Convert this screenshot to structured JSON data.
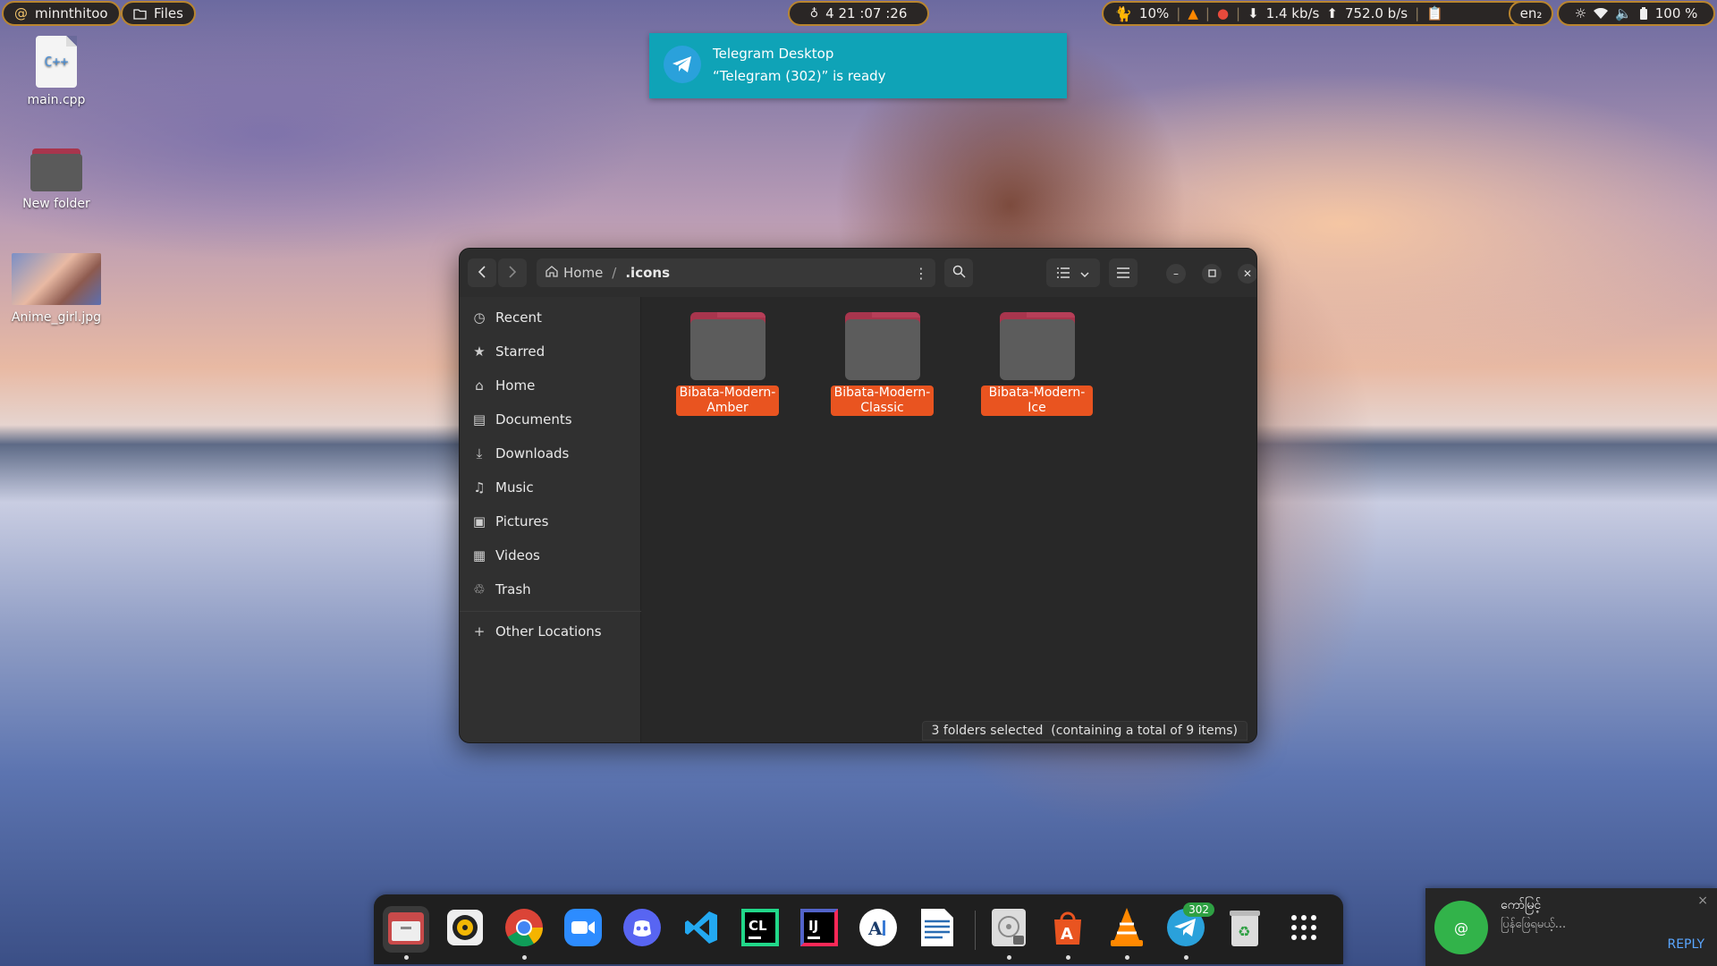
{
  "topbar": {
    "user": "minnthitoo",
    "user_icon": "at-sign-icon",
    "app": "Files",
    "clock": "4 21 :07 :26",
    "cpu": "10%",
    "net_down": "1.4 kb/s",
    "net_up": "752.0  b/s",
    "lang": "en₂",
    "battery": "100 %"
  },
  "desktop": {
    "items": [
      {
        "label": "main.cpp",
        "glyph": "C++"
      },
      {
        "label": "New folder"
      },
      {
        "label": "Anime_girl.jpg"
      }
    ]
  },
  "notification": {
    "app": "Telegram Desktop",
    "message": "“Telegram (302)” is ready"
  },
  "files": {
    "path_home": "Home",
    "path_current": ".icons",
    "sidebar": [
      {
        "label": "Recent",
        "icon": "clock-icon"
      },
      {
        "label": "Starred",
        "icon": "star-icon"
      },
      {
        "label": "Home",
        "icon": "home-icon"
      },
      {
        "label": "Documents",
        "icon": "document-icon"
      },
      {
        "label": "Downloads",
        "icon": "download-icon"
      },
      {
        "label": "Music",
        "icon": "music-icon"
      },
      {
        "label": "Pictures",
        "icon": "picture-icon"
      },
      {
        "label": "Videos",
        "icon": "video-icon"
      },
      {
        "label": "Trash",
        "icon": "trash-icon"
      },
      {
        "label": "Other Locations",
        "icon": "plus-icon"
      }
    ],
    "folders": [
      {
        "line1": "Bibata-Modern-",
        "line2": "Amber"
      },
      {
        "line1": "Bibata-Modern-",
        "line2": "Classic"
      },
      {
        "line1": "Bibata-Modern-Ice",
        "line2": ""
      }
    ],
    "status": "3 folders selected  (containing a total of 9 items)"
  },
  "dock": {
    "apps": [
      {
        "name": "Files",
        "icon": "files-icon",
        "color": "#c94a4a"
      },
      {
        "name": "Rhythmbox",
        "icon": "rhythmbox-icon",
        "color": "#f2b705"
      },
      {
        "name": "Chrome",
        "icon": "chrome-icon",
        "color": "#4285f4"
      },
      {
        "name": "Zoom",
        "icon": "zoom-icon",
        "color": "#2d8cff"
      },
      {
        "name": "Discord",
        "icon": "discord-icon",
        "color": "#5865f2"
      },
      {
        "name": "VS Code",
        "icon": "vscode-icon",
        "color": "#23a9f2"
      },
      {
        "name": "CLion",
        "icon": "clion-icon",
        "color": "#21d789",
        "text": "CL"
      },
      {
        "name": "IntelliJ IDEA",
        "icon": "intellij-icon",
        "color": "#fe2857",
        "text": "IJ"
      },
      {
        "name": "Typora",
        "icon": "typora-icon",
        "color": "#ffffff"
      },
      {
        "name": "LibreOffice Writer",
        "icon": "writer-icon",
        "color": "#2a6db3"
      },
      {
        "name": "Disks",
        "icon": "disks-icon",
        "color": "#9a9a9a"
      },
      {
        "name": "App Center",
        "icon": "app-center-icon",
        "color": "#e95420"
      },
      {
        "name": "VLC",
        "icon": "vlc-icon",
        "color": "#ff8800"
      },
      {
        "name": "Telegram",
        "icon": "telegram-icon",
        "color": "#2aa1db",
        "badge": "302"
      },
      {
        "name": "Trash",
        "icon": "trash-icon",
        "color": "#dcdcdc"
      },
      {
        "name": "Show Apps",
        "icon": "grid-icon",
        "color": "#ffffff"
      }
    ]
  },
  "message": {
    "avatar_glyph": "@",
    "name": "ကော်မြင့်",
    "text": "ပြန်ဖြေရမယ့်...",
    "reply": "REPLY",
    "close": "×"
  }
}
